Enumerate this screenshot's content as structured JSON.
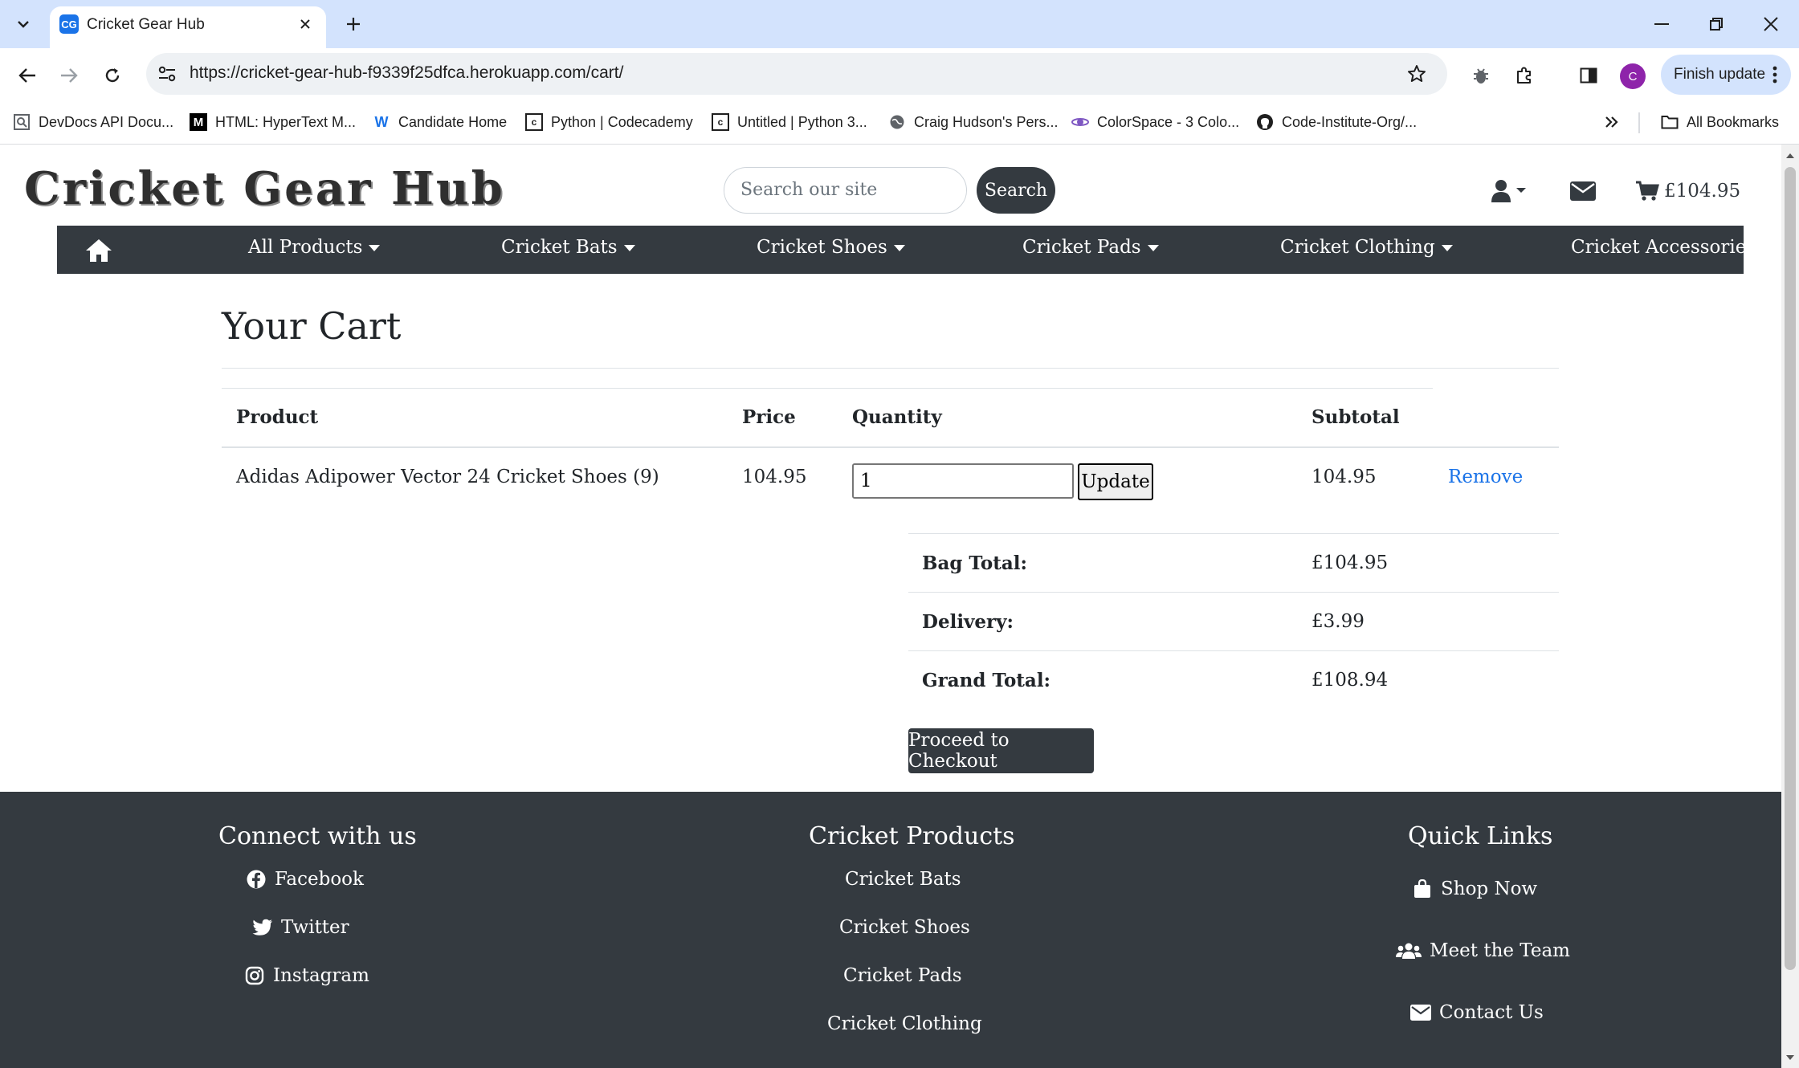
{
  "browser": {
    "tab_title": "Cricket Gear Hub",
    "favicon_text": "CG",
    "url": "https://cricket-gear-hub-f9339f25dfca.herokuapp.com/cart/",
    "profile_initial": "C",
    "finish_update_label": "Finish update",
    "bookmarks": [
      {
        "label": "DevDocs API Docu...",
        "icon": "devdocs-icon"
      },
      {
        "label": "HTML: HyperText M...",
        "icon": "mdn-icon"
      },
      {
        "label": "Candidate Home",
        "icon": "w-icon"
      },
      {
        "label": "Python | Codecademy",
        "icon": "codecademy-icon"
      },
      {
        "label": "Untitled | Python 3...",
        "icon": "codecademy-icon"
      },
      {
        "label": "Craig Hudson's Pers...",
        "icon": "globe-icon"
      },
      {
        "label": "ColorSpace - 3 Colo...",
        "icon": "colorspace-icon"
      },
      {
        "label": "Code-Institute-Org/...",
        "icon": "github-icon"
      }
    ],
    "all_bookmarks_label": "All Bookmarks"
  },
  "header": {
    "logo": "Cricket Gear Hub",
    "search_placeholder": "Search our site",
    "search_button": "Search",
    "cart_total": "£104.95"
  },
  "nav": {
    "items": [
      "All Products",
      "Cricket Bats",
      "Cricket Shoes",
      "Cricket Pads",
      "Cricket Clothing",
      "Cricket Accessories"
    ]
  },
  "cart": {
    "heading": "Your Cart",
    "columns": {
      "product": "Product",
      "price": "Price",
      "quantity": "Quantity",
      "subtotal": "Subtotal"
    },
    "rows": [
      {
        "product": "Adidas Adipower Vector 24 Cricket Shoes (9)",
        "price": "104.95",
        "quantity": "1",
        "subtotal": "104.95",
        "update_label": "Update",
        "remove_label": "Remove"
      }
    ],
    "summary": {
      "bag_total_label": "Bag Total:",
      "bag_total": "£104.95",
      "delivery_label": "Delivery:",
      "delivery": "£3.99",
      "grand_total_label": "Grand Total:",
      "grand_total": "£108.94"
    },
    "checkout_label": "Proceed to Checkout"
  },
  "footer": {
    "connect": {
      "heading": "Connect with us",
      "links": [
        "Facebook",
        "Twitter",
        "Instagram"
      ]
    },
    "products": {
      "heading": "Cricket Products",
      "links": [
        "Cricket Bats",
        "Cricket Shoes",
        "Cricket Pads",
        "Cricket Clothing"
      ]
    },
    "quick": {
      "heading": "Quick Links",
      "links": [
        "Shop Now",
        "Meet the Team",
        "Contact Us"
      ]
    }
  }
}
